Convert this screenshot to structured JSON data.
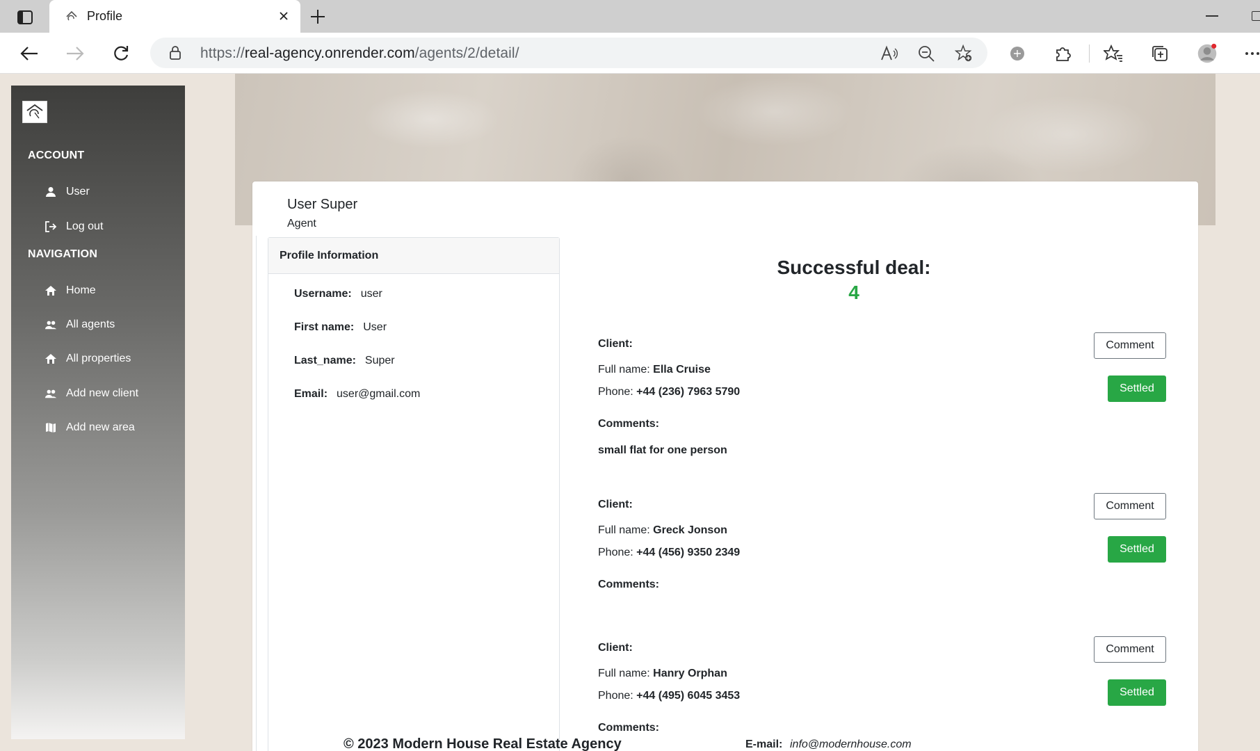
{
  "browser": {
    "tab_title": "Profile",
    "url_scheme": "https://",
    "url_host": "real-agency.onrender.com",
    "url_path": "/agents/2/detail/"
  },
  "sidebar": {
    "account_heading": "ACCOUNT",
    "account_items": [
      {
        "label": "User",
        "icon": "person-icon"
      },
      {
        "label": "Log out",
        "icon": "logout-icon"
      }
    ],
    "navigation_heading": "NAVIGATION",
    "nav_items": [
      {
        "label": "Home",
        "icon": "home-icon"
      },
      {
        "label": "All agents",
        "icon": "people-icon"
      },
      {
        "label": "All properties",
        "icon": "houses-icon"
      },
      {
        "label": "Add new client",
        "icon": "people-icon"
      },
      {
        "label": "Add new area",
        "icon": "map-icon"
      }
    ]
  },
  "profile": {
    "name": "User Super",
    "role": "Agent",
    "info_title": "Profile Information",
    "fields": [
      {
        "label": "Username:",
        "value": "user"
      },
      {
        "label": "First name:",
        "value": "User"
      },
      {
        "label": "Last_name:",
        "value": "Super"
      },
      {
        "label": "Email:",
        "value": "user@gmail.com"
      }
    ]
  },
  "deals": {
    "title": "Successful deal:",
    "count": "4",
    "client_label": "Client:",
    "fullname_label": "Full name:",
    "phone_label": "Phone:",
    "comments_label": "Comments:",
    "comment_button": "Comment",
    "settled_button": "Settled",
    "clients": [
      {
        "full_name": "Ella Cruise",
        "phone": "+44 (236) 7963 5790",
        "comment": "small flat for one person"
      },
      {
        "full_name": "Greck Jonson",
        "phone": "+44 (456) 9350 2349",
        "comment": ""
      },
      {
        "full_name": "Hanry Orphan",
        "phone": "+44 (495) 6045 3453",
        "comment": ""
      }
    ]
  },
  "footer": {
    "copyright": "© 2023 Modern House Real Estate Agency",
    "email_label": "E-mail:",
    "email": "info@modernhouse.com"
  },
  "colors": {
    "success": "#28a745",
    "sidebar_top": "#3e3e3c"
  }
}
